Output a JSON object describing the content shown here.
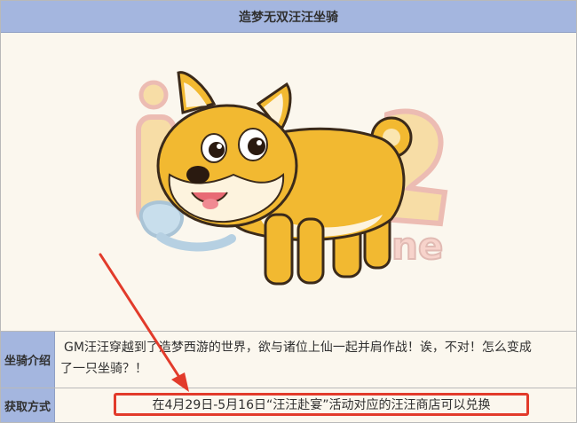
{
  "header": {
    "title": "造梦无双汪汪坐骑"
  },
  "image": {
    "subject_icon": "shiba-dog-mount-illustration"
  },
  "intro": {
    "label": "坐骑介绍",
    "text_line1": "GM汪汪穿越到了造梦西游的世界，欲与诸位上仙一起并肩作战！诶，不对！怎么变成",
    "text_line2": "了一只坐骑？！"
  },
  "acquire": {
    "label": "获取方式",
    "text": "在4月29日-5月16日“汪汪赴宴”活动对应的汪汪商店可以兑换"
  },
  "colors": {
    "header_bg": "#a4b6df",
    "body_bg": "#fbf7ee",
    "highlight": "#e23b2b"
  }
}
